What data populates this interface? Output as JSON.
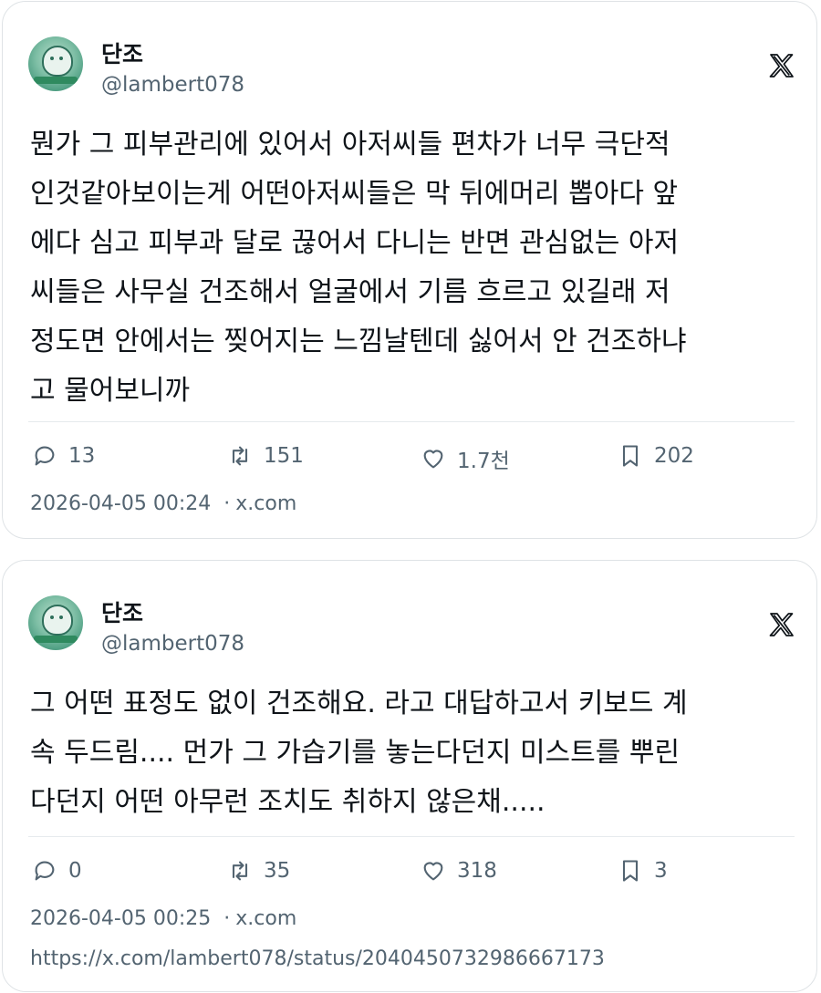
{
  "tweets": [
    {
      "author": {
        "name": "단조",
        "handle": "@lambert078"
      },
      "text": "뭔가 그 피부관리에 있어서 아저씨들 편차가 너무 극단적\n인것같아보이는게 어떤아저씨들은 막 뒤에머리 뽑아다 앞\n에다 심고 피부과 달로 끊어서 다니는 반면 관심없는 아저\n씨들은 사무실 건조해서 얼굴에서 기름 흐르고 있길래 저\n정도면 안에서는 찢어지는 느낌날텐데 싫어서 안 건조하냐\n고 물어보니까",
      "stats": {
        "replies": "13",
        "retweets": "151",
        "likes": "1.7천",
        "bookmarks": "202"
      },
      "timestamp": "2026-04-05 00:24",
      "source": "x.com"
    },
    {
      "author": {
        "name": "단조",
        "handle": "@lambert078"
      },
      "text": "그 어떤 표정도 없이 건조해요. 라고 대답하고서 키보드 계\n속 두드림.... 먼가 그 가습기를 놓는다던지 미스트를 뿌린\n다던지 어떤 아무런 조치도 취하지 않은채.....",
      "stats": {
        "replies": "0",
        "retweets": "35",
        "likes": "318",
        "bookmarks": "3"
      },
      "timestamp": "2026-04-05 00:25",
      "source": "x.com",
      "url": "https://x.com/lambert078/status/2040450732986667173"
    }
  ],
  "icons": {
    "reply": "reply-icon",
    "retweet": "retweet-icon",
    "like": "heart-icon",
    "bookmark": "bookmark-icon",
    "platform": "x-logo-icon"
  },
  "colors": {
    "text": "#0f1419",
    "secondary": "#536471",
    "border": "#dfe3e6"
  }
}
